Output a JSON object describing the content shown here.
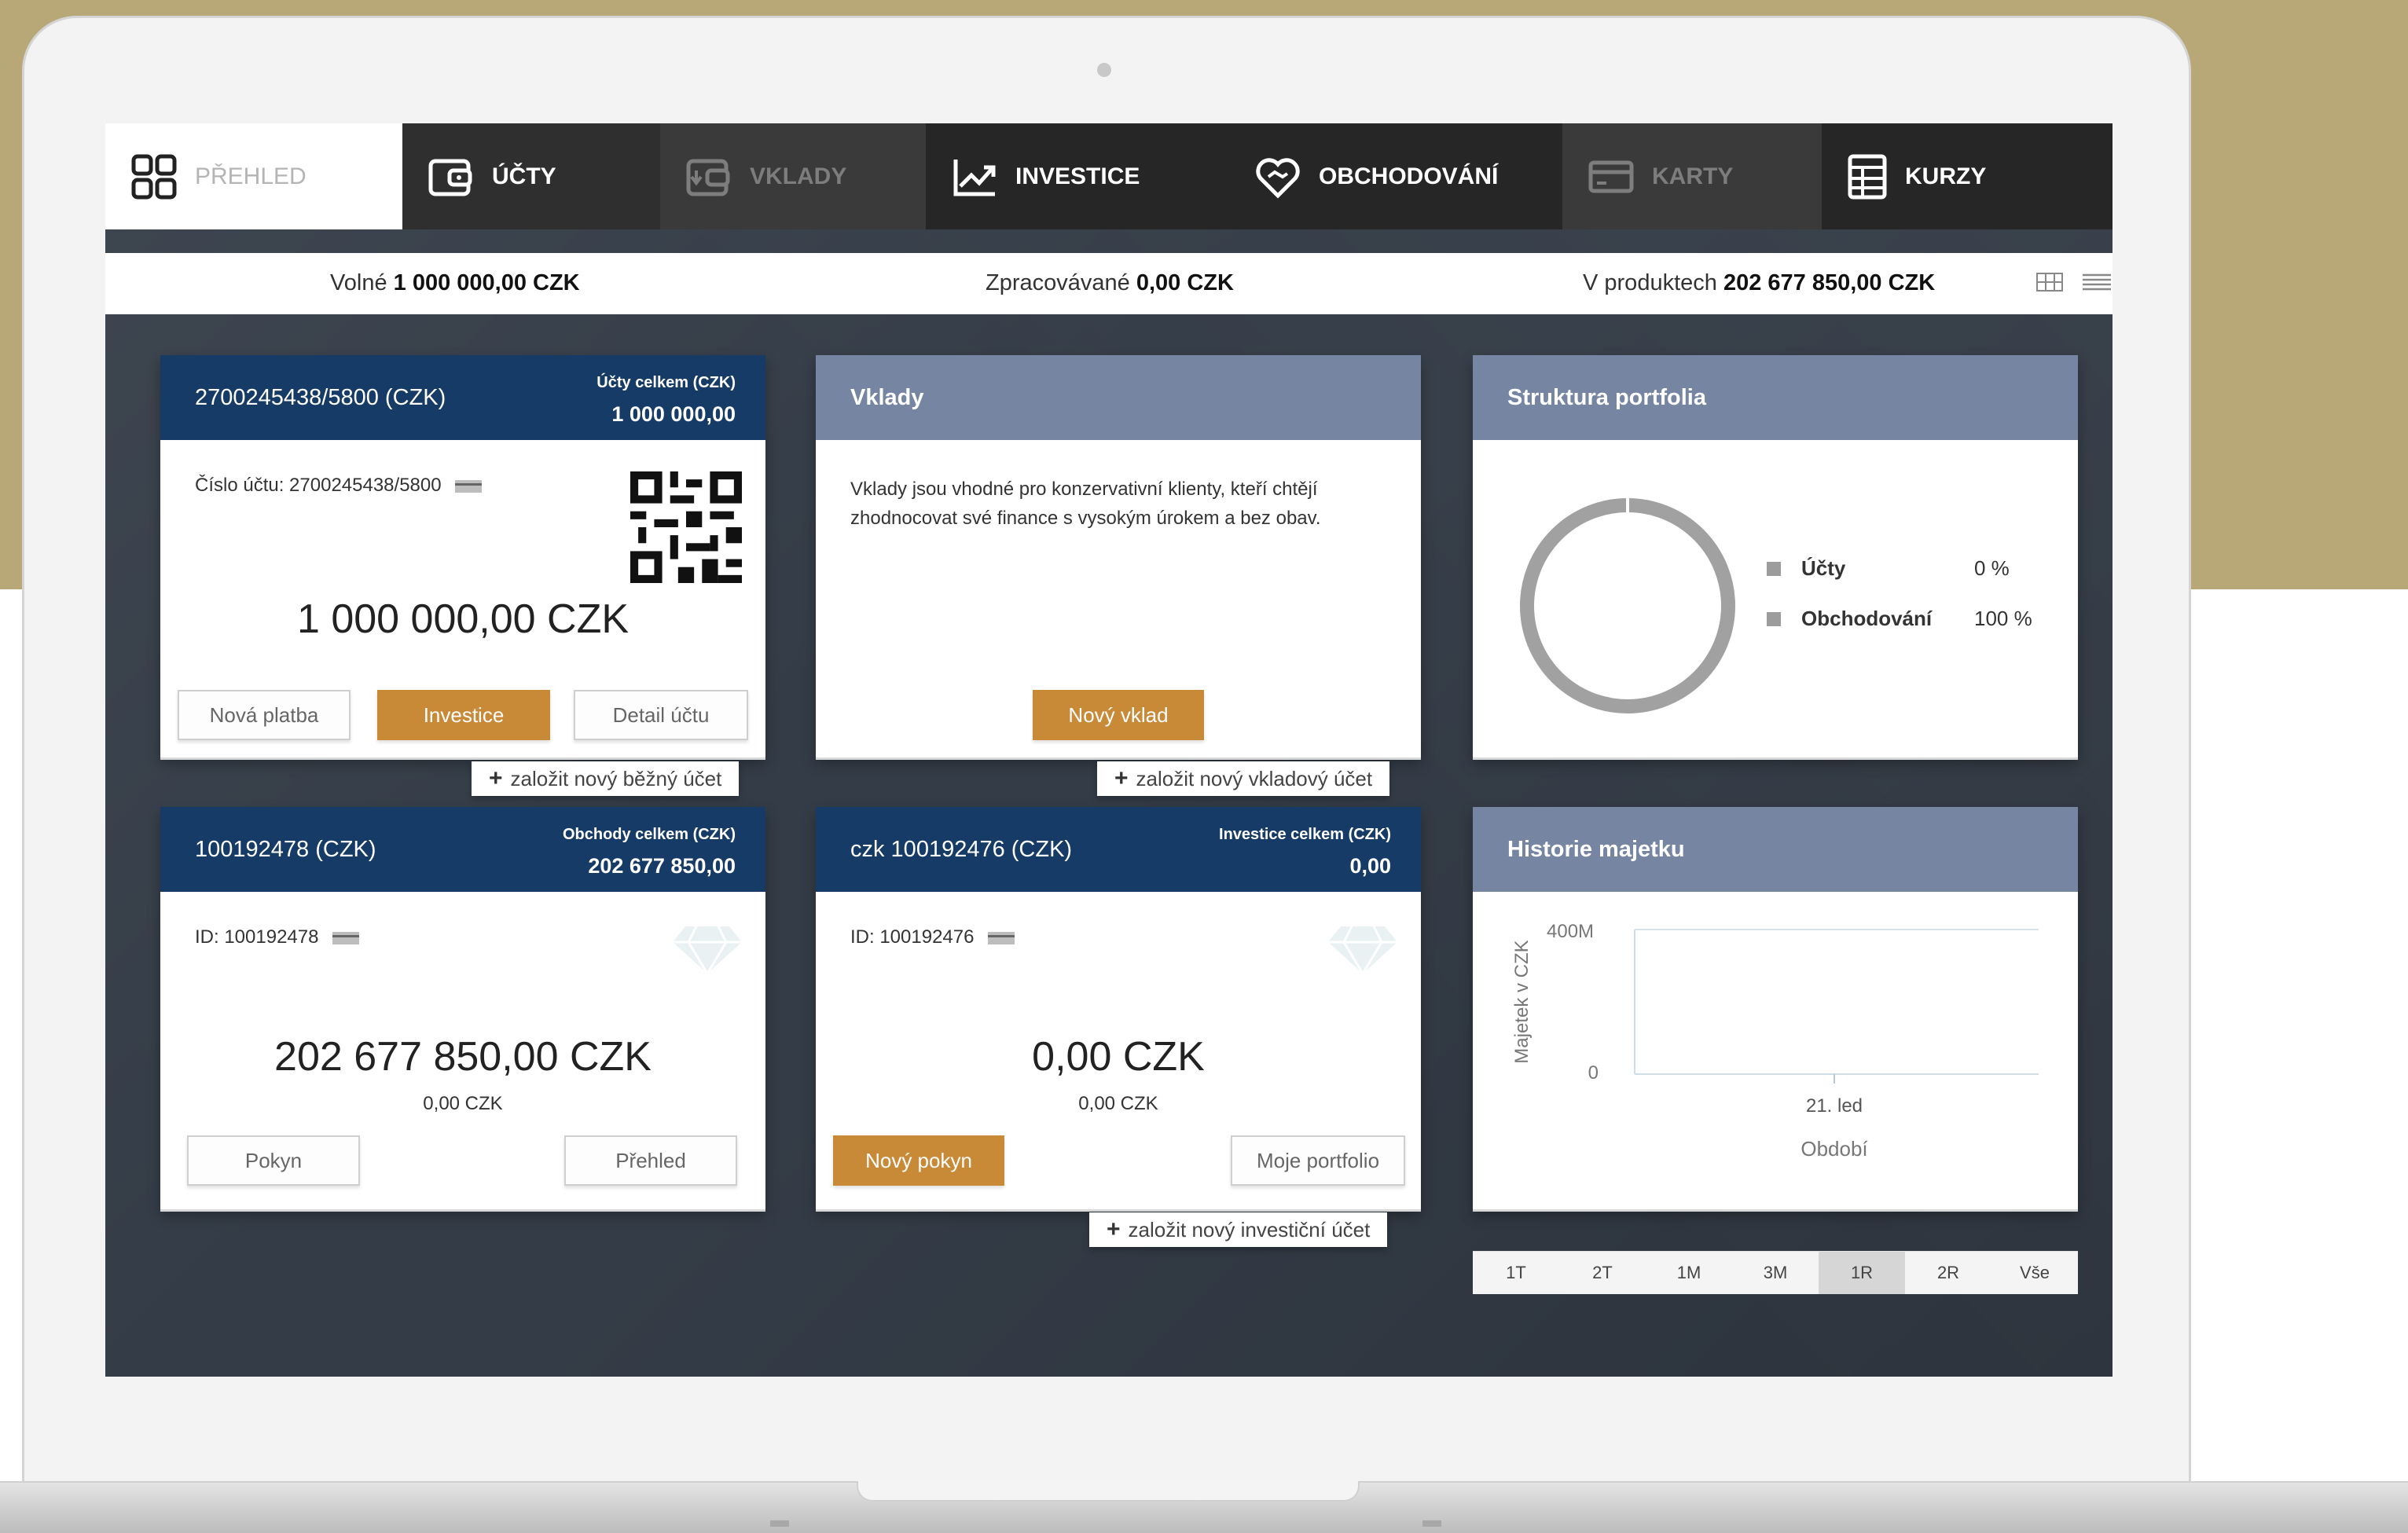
{
  "nav": {
    "items": [
      {
        "label": "PŘEHLED",
        "icon": "dashboard-grid-icon"
      },
      {
        "label": "ÚČTY",
        "icon": "wallet-icon"
      },
      {
        "label": "VKLADY",
        "icon": "deposit-icon"
      },
      {
        "label": "INVESTICE",
        "icon": "chart-line-icon"
      },
      {
        "label": "OBCHODOVÁNÍ",
        "icon": "handshake-heart-icon"
      },
      {
        "label": "KARTY",
        "icon": "card-icon"
      },
      {
        "label": "KURZY",
        "icon": "table-grid-icon"
      }
    ]
  },
  "summary": {
    "free_label": "Volné",
    "free_value": "1 000 000,00 CZK",
    "processing_label": "Zpracovávané",
    "processing_value": "0,00 CZK",
    "products_label": "V produktech",
    "products_value": "202 677 850,00 CZK"
  },
  "account_card": {
    "title": "2700245438/5800 (CZK)",
    "sub_label": "Účty celkem (CZK)",
    "sub_value": "1 000 000,00",
    "number_line": "Číslo účtu: 2700245438/5800",
    "balance": "1 000 000,00 CZK",
    "btn_payment": "Nová platba",
    "btn_invest": "Investice",
    "btn_detail": "Detail účtu",
    "new_link": "založit nový běžný účet"
  },
  "deposits_card": {
    "title": "Vklady",
    "text": "Vklady jsou vhodné pro konzervativní klienty, kteří chtějí zhodnocovat své finance s vysokým úrokem a bez obav.",
    "btn_new": "Nový vklad",
    "new_link": "založit nový vkladový účet"
  },
  "portfolio_card": {
    "title": "Struktura portfolia",
    "legend": [
      {
        "name": "Účty",
        "value": "0 %"
      },
      {
        "name": "Obchodování",
        "value": "100 %"
      }
    ]
  },
  "trading_card": {
    "title": "100192478 (CZK)",
    "sub_label": "Obchody celkem (CZK)",
    "sub_value": "202 677 850,00",
    "id_line": "ID: 100192478",
    "balance": "202 677 850,00 CZK",
    "secondary": "0,00 CZK",
    "btn_order": "Pokyn",
    "btn_overview": "Přehled"
  },
  "invest_card": {
    "title": "czk 100192476 (CZK)",
    "sub_label": "Investice celkem (CZK)",
    "sub_value": "0,00",
    "id_line": "ID: 100192476",
    "balance": "0,00 CZK",
    "secondary": "0,00 CZK",
    "btn_order": "Nový pokyn",
    "btn_portfolio": "Moje portfolio",
    "new_link": "založit nový investiční účet"
  },
  "history_card": {
    "title": "Historie majetku",
    "periods": [
      "1T",
      "2T",
      "1M",
      "3M",
      "1R",
      "2R",
      "Vše"
    ],
    "selected_period": "1R"
  },
  "chart_data": {
    "type": "line",
    "title": "Historie majetku",
    "xlabel": "Období",
    "ylabel": "Majetek v CZK",
    "yticks": [
      "400M",
      "0"
    ],
    "xticks": [
      "21. led"
    ],
    "ylim": [
      0,
      400000000
    ],
    "series": []
  },
  "colors": {
    "brand_gold": "#c98a37",
    "header_blue": "#163b66",
    "header_gray": "#7585a2",
    "nav_bg": "#2f2f2f"
  }
}
